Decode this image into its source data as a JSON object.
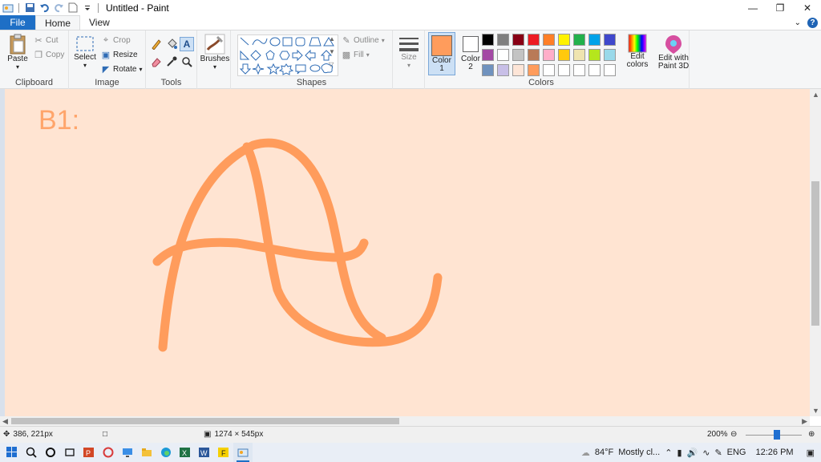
{
  "window": {
    "title": "Untitled - Paint",
    "controls": [
      "minimize-icon",
      "restore-icon",
      "close-icon"
    ]
  },
  "tabs": [
    {
      "label": "File"
    },
    {
      "label": "Home"
    },
    {
      "label": "View"
    }
  ],
  "ribbon": {
    "clipboard": {
      "paste": "Paste",
      "cut": "Cut",
      "copy": "Copy",
      "group": "Clipboard"
    },
    "image": {
      "select": "Select",
      "crop": "Crop",
      "resize": "Resize",
      "rotate": "Rotate",
      "group": "Image"
    },
    "tools": {
      "group": "Tools",
      "text_glyph": "A"
    },
    "brushes": {
      "label": "Brushes"
    },
    "shapes": {
      "group": "Shapes",
      "outline": "Outline",
      "fill": "Fill"
    },
    "size": {
      "label": "Size"
    },
    "colors": {
      "group": "Colors",
      "color1": "Color 1",
      "color1_value": "#ff9c5c",
      "color2": "Color 2",
      "color2_value": "#ffffff",
      "edit_colors": "Edit colors",
      "edit_paint3d": "Edit with Paint 3D",
      "palette": [
        "#000000",
        "#7f7f7f",
        "#880015",
        "#ed1c24",
        "#ff7f27",
        "#fff200",
        "#22b14c",
        "#00a2e8",
        "#3f48cc",
        "#a349a4",
        "#ffffff",
        "#c3c3c3",
        "#b97a57",
        "#ffaec9",
        "#ffc90e",
        "#efe4b0",
        "#b5e61d",
        "#99d9ea",
        "#7092be",
        "#c8bfe7",
        "#fde5d7",
        "#ff9c5c",
        "#ffffff",
        "#ffffff",
        "#ffffff",
        "#ffffff",
        "#ffffff",
        "#ffffff",
        "#ffffff",
        "#ffffff"
      ]
    }
  },
  "canvas": {
    "text": "B1:",
    "background": "#ffe4d2",
    "stroke_color": "#ff9c5c"
  },
  "status": {
    "cursor_pos": "386, 221px",
    "canvas_size": "1274 × 545px",
    "zoom": "200%"
  },
  "taskbar": {
    "weather_temp": "84°F",
    "weather_text": "Mostly cl...",
    "language": "ENG",
    "time": "12:26 PM"
  }
}
